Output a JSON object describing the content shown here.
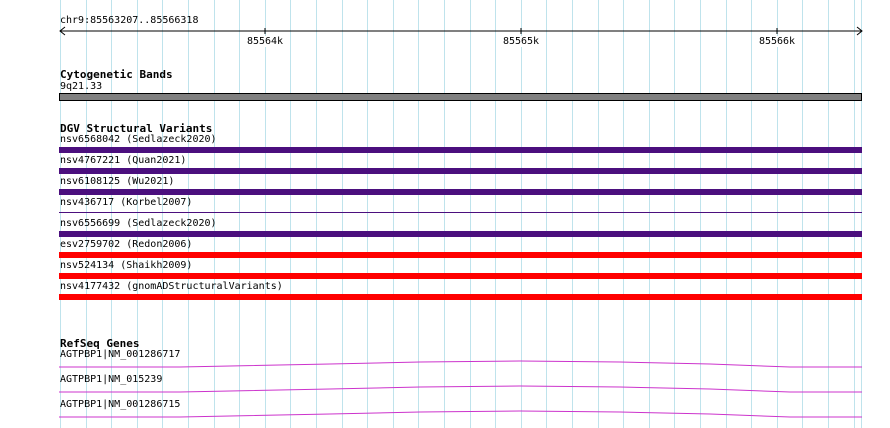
{
  "ruler": {
    "position_label": "chr9:85563207..85566318",
    "ticks": [
      {
        "label": "85564k"
      },
      {
        "label": "85565k"
      },
      {
        "label": "85566k"
      }
    ]
  },
  "cytoband": {
    "title": "Cytogenetic Bands",
    "band_label": "9q21.33",
    "color": "#808080"
  },
  "dgv": {
    "title": "DGV Structural Variants",
    "items": [
      {
        "label": "nsv6568042 (Sedlazeck2020)",
        "color": "#4b0f7e"
      },
      {
        "label": "nsv4767221 (Quan2021)",
        "color": "#4b0f7e"
      },
      {
        "label": "nsv6108125 (Wu2021)",
        "color": "#4b0f7e"
      },
      {
        "label": "nsv436717 (Korbel2007)",
        "color": "#4b0f7e"
      },
      {
        "label": "nsv6556699 (Sedlazeck2020)",
        "color": "#4b0f7e"
      },
      {
        "label": "esv2759702 (Redon2006)",
        "color": "#ff0000"
      },
      {
        "label": "nsv524134 (Shaikh2009)",
        "color": "#ff0000"
      },
      {
        "label": "nsv4177432 (gnomADStructuralVariants)",
        "color": "#ff0000"
      }
    ]
  },
  "refseq": {
    "title": "RefSeq Genes",
    "color": "#cc33cc",
    "genes": [
      {
        "label": "AGTPBP1|NM_001286717"
      },
      {
        "label": "AGTPBP1|NM_015239"
      },
      {
        "label": "AGTPBP1|NM_001286715"
      }
    ]
  }
}
